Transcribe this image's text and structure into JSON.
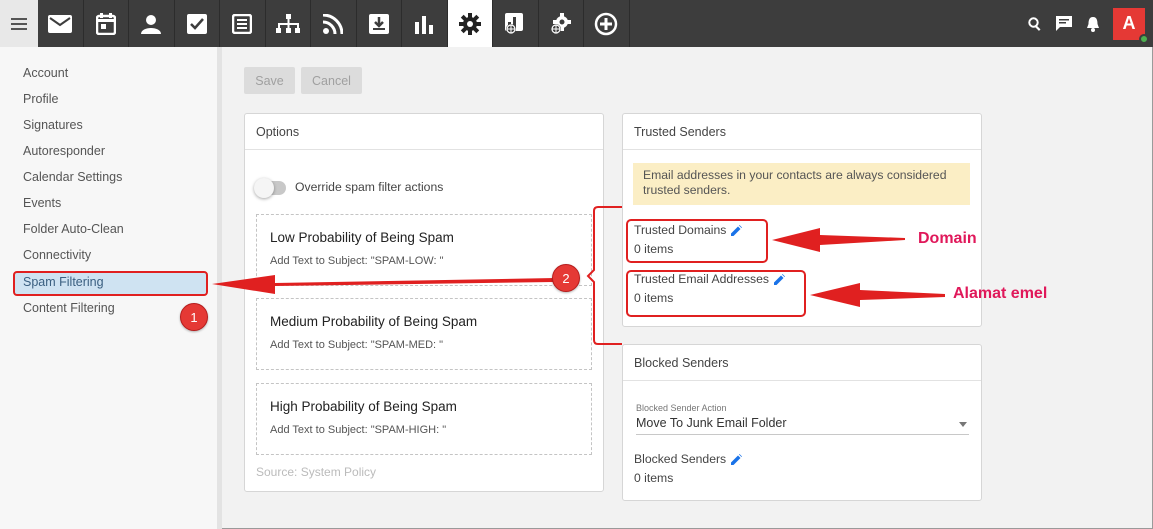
{
  "topbar": {
    "apps": [
      {
        "icon": "mail-icon"
      },
      {
        "icon": "calendar-icon"
      },
      {
        "icon": "contacts-icon"
      },
      {
        "icon": "tasks-icon"
      },
      {
        "icon": "notes-icon"
      },
      {
        "icon": "sitemap-icon"
      },
      {
        "icon": "rss-icon"
      },
      {
        "icon": "archive-icon"
      },
      {
        "icon": "reports-icon"
      },
      {
        "icon": "settings-gear-icon",
        "active": true
      },
      {
        "icon": "domain-reports-icon"
      },
      {
        "icon": "domain-settings-icon"
      },
      {
        "icon": "add-circle-icon"
      }
    ],
    "avatar_letter": "A"
  },
  "sidebar": {
    "items": [
      {
        "label": "Account"
      },
      {
        "label": "Profile"
      },
      {
        "label": "Signatures"
      },
      {
        "label": "Autoresponder"
      },
      {
        "label": "Calendar Settings"
      },
      {
        "label": "Events"
      },
      {
        "label": "Folder Auto-Clean"
      },
      {
        "label": "Connectivity"
      },
      {
        "label": "Spam Filtering",
        "selected": true
      },
      {
        "label": "Content Filtering"
      }
    ]
  },
  "toolbar": {
    "save_label": "Save",
    "cancel_label": "Cancel"
  },
  "options": {
    "title": "Options",
    "override_label": "Override spam filter actions",
    "levels": [
      {
        "title": "Low Probability of Being Spam",
        "subtitle": "Add Text to Subject: \"SPAM-LOW: \""
      },
      {
        "title": "Medium Probability of Being Spam",
        "subtitle": "Add Text to Subject: \"SPAM-MED: \""
      },
      {
        "title": "High Probability of Being Spam",
        "subtitle": "Add Text to Subject: \"SPAM-HIGH: \""
      }
    ],
    "source": "Source: System Policy"
  },
  "trusted": {
    "title": "Trusted Senders",
    "notice": "Email addresses in your contacts are always considered trusted senders.",
    "domains_label": "Trusted Domains",
    "domains_count": "0 items",
    "emails_label": "Trusted Email Addresses",
    "emails_count": "0 items"
  },
  "blocked": {
    "title": "Blocked Senders",
    "action_label": "Blocked Sender Action",
    "action_value": "Move To Junk Email Folder",
    "senders_label": "Blocked Senders",
    "senders_count": "0 items"
  },
  "annotations": {
    "badge1": "1",
    "badge2": "2",
    "domain": "Domain",
    "email": "Alamat emel"
  },
  "colors": {
    "topbar": "#3d3d3d",
    "annotation_red": "#e02020",
    "annotation_text": "#e0185a",
    "notice_bg": "#fbeec5",
    "avatar": "#e53935"
  }
}
